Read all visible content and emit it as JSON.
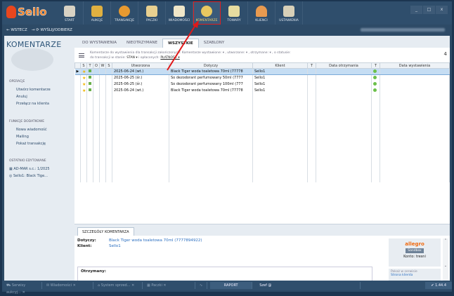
{
  "app": {
    "logo": "Sello",
    "window_controls": [
      "_",
      "□",
      "x"
    ]
  },
  "nav": [
    "START",
    "AUKCJE",
    "TRANSAKCJE",
    "PACZKI",
    "WIADOMOŚCI",
    "KOMENTARZE",
    "TOWARY",
    "KLIENCI",
    "USTAWIENIA"
  ],
  "toolbar": {
    "back": "WSTECZ",
    "sync": "WYŚLIJ/ODBIERZ"
  },
  "sidebar": {
    "title": "KOMENTARZE",
    "ops_title": "OPERACJE",
    "ops": [
      "Utwórz komentarze",
      "Anuluj",
      "Przełącz na klienta"
    ],
    "extra_title": "FUNKCJE DODATKOWE",
    "extra": [
      "Nowa wiadomość",
      "Mailing",
      "Pokaż transakcję"
    ],
    "recent_title": "OSTATNIO EDYTOWANE",
    "recent": [
      "AD-MAR s.c.: 1/2025",
      "Sello1: Black Tige..."
    ]
  },
  "tabs": [
    "DO WYSTAWIENIA",
    "NIEOTRZYMANE",
    "WSZYSTKIE",
    "SZABLONY"
  ],
  "filter": {
    "line1": "Komentarze do wystawienia dla transakcji zakończonych: Komentarze wystawione: ▾ , utworzone: ▾ , otrzymane: ▾ , o statusie:",
    "line2a": "do transakcji w stanie:",
    "stan": "STAN ▾",
    "line2b": "i opłaconych:",
    "platnosc": "PŁATNOŚĆ ▾",
    "count": "4"
  },
  "table": {
    "headers": [
      "",
      "S",
      "T",
      "O",
      "W",
      "S",
      "Utworzona",
      "Dotyczy",
      "Klient",
      "T",
      "Data otrzymania",
      "T",
      "Data wystawienia"
    ],
    "rows": [
      {
        "date": "2025-06-24 (wt.)",
        "item": "Black Tiger woda toaletowa 70ml (77778",
        "client": "Sello1"
      },
      {
        "date": "2025-06-25 (śr.)",
        "item": "So dezodorant perfumowany 50ml (7777",
        "client": "Sello1"
      },
      {
        "date": "2025-06-25 (śr.)",
        "item": "So dezodorant perfumowany 100ml (777",
        "client": "Sello1"
      },
      {
        "date": "2025-06-24 (wt.)",
        "item": "Black Tiger woda toaletowa 70ml (77778",
        "client": "Sello1"
      }
    ]
  },
  "details": {
    "tab": "SZCZEGÓŁY KOMENTARZA",
    "dotyczy_label": "Dotyczy:",
    "dotyczy": "Black Tiger woda toaletowa 70ml (7777894922)",
    "klient_label": "Klient:",
    "klient": "Sello1",
    "received": "Otrzymany:",
    "allegro": "allegro",
    "sandbox": "Sandbox",
    "konto": "Konto: tresni",
    "show": "Pokaż w serwisie",
    "client_page": "Strona klienta"
  },
  "status": {
    "tabs": [
      "Serwisy aukcyj...",
      "Wiadomości",
      "System sprzed...",
      "Paczki"
    ],
    "report": "RAPORT",
    "user": "Szef @",
    "version": "1.44.4"
  }
}
